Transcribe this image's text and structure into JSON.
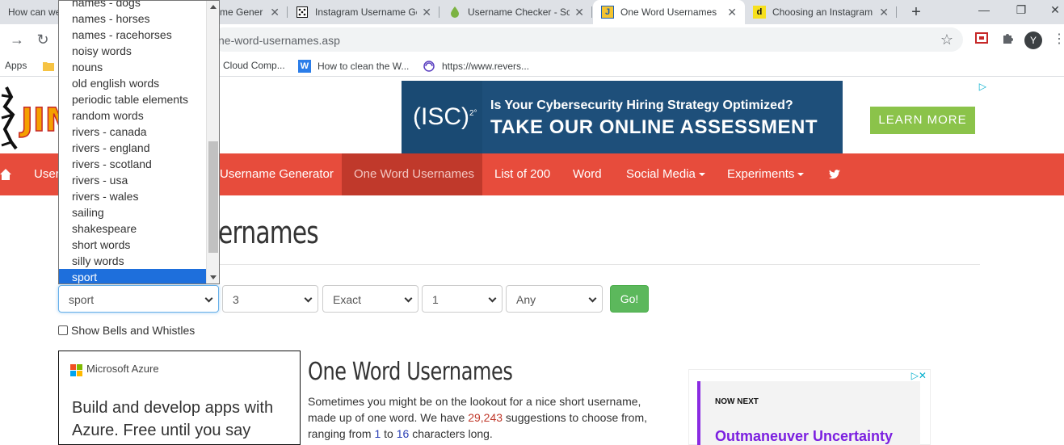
{
  "browser": {
    "tabs": [
      {
        "title": "How can we",
        "icon": "chrome-tab-icon"
      },
      {
        "title": "me Gener",
        "icon": "generic-tab-icon"
      },
      {
        "title": "Instagram Username Ge",
        "icon": "dice-icon"
      },
      {
        "title": "Username Checker - Sc",
        "icon": "drop-icon"
      },
      {
        "title": "One Word Usernames",
        "icon": "jimpix-icon"
      },
      {
        "title": "Choosing an Instagram",
        "icon": "d-icon"
      }
    ],
    "active_tab": "One Word Usernames",
    "url": "ne-word-usernames.asp",
    "avatar_letter": "Y",
    "bookmarks": [
      {
        "label": "Apps"
      },
      {
        "label": "Cloud Comp..."
      },
      {
        "label": "How to clean the W..."
      },
      {
        "label": "https://www.revers..."
      }
    ],
    "bookmark_w_letter": "W"
  },
  "ad_banner": {
    "brand": "(ISC)",
    "brand_sup": "2°",
    "question": "Is Your Cybersecurity Hiring Strategy Optimized?",
    "tagline": "TAKE OUR ONLINE ASSESSMENT",
    "cta": "LEARN MORE"
  },
  "nav": {
    "items": [
      {
        "label": "User"
      },
      {
        "label": "Username Generator"
      },
      {
        "label": "One Word Usernames"
      },
      {
        "label": "List of 200"
      },
      {
        "label": "Word"
      },
      {
        "label": "Social Media"
      },
      {
        "label": "Experiments"
      }
    ],
    "active": "One Word Usernames"
  },
  "page": {
    "heading_partial": "ernames",
    "checkbox_label": "Show Bells and Whistles",
    "go_label": "Go!"
  },
  "form": {
    "category": "sport",
    "length": "3",
    "match": "Exact",
    "count": "1",
    "start": "Any"
  },
  "dropdown": {
    "options": [
      "names - dogs",
      "names - horses",
      "names - racehorses",
      "noisy words",
      "nouns",
      "old english words",
      "periodic table elements",
      "random words",
      "rivers - canada",
      "rivers - england",
      "rivers - scotland",
      "rivers - usa",
      "rivers - wales",
      "sailing",
      "shakespeare",
      "short words",
      "silly words",
      "sport"
    ],
    "selected": "sport"
  },
  "azure_ad": {
    "brand": "Microsoft Azure",
    "body": "Build and develop apps with Azure. Free until you say"
  },
  "article": {
    "title": "One Word Usernames",
    "intro_before": "Sometimes you might be on the lookout for a nice short username, made up of one word. We have ",
    "count": "29,243",
    "intro_mid": " suggestions to choose from, ranging from ",
    "min": "1",
    "to": " to ",
    "max": "16",
    "intro_after": " characters long."
  },
  "right_ad": {
    "brand": "NOW NEXT",
    "headline": "Outmaneuver Uncertainty"
  },
  "colors": {
    "nav_red": "#e74c3c",
    "nav_active": "#c0392b",
    "go_green": "#5cb85c",
    "select_highlight": "#1e6fdc"
  }
}
